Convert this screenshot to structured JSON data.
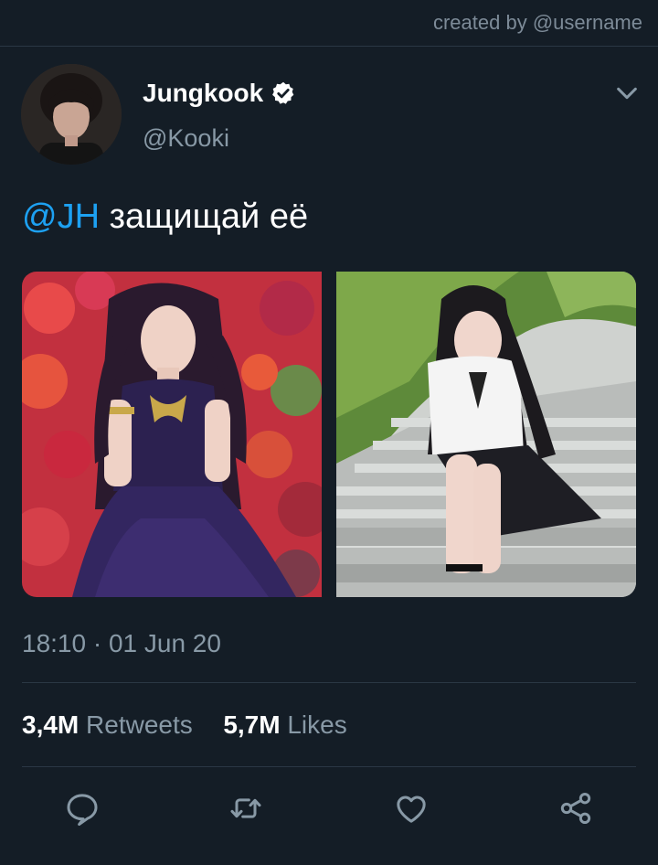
{
  "watermark": "created by @username",
  "author": {
    "display_name": "Jungkook",
    "handle": "@Kooki",
    "verified": true,
    "avatar_icon": "profile-photo"
  },
  "tweet": {
    "mention": "@JH",
    "text": " защищай её",
    "photos": [
      {
        "name": "photo-woman-purple-dress"
      },
      {
        "name": "photo-woman-on-stairs"
      }
    ],
    "timestamp": "18:10 · 01 Jun 20"
  },
  "stats": {
    "retweets_count": "3,4M",
    "retweets_label": "Retweets",
    "likes_count": "5,7M",
    "likes_label": "Likes"
  },
  "actions": [
    "reply-icon",
    "retweet-icon",
    "like-icon",
    "share-icon"
  ],
  "colors": {
    "background": "#141d26",
    "accent": "#1da1f2",
    "secondary_text": "#8899a6",
    "divider": "#2a3744"
  }
}
